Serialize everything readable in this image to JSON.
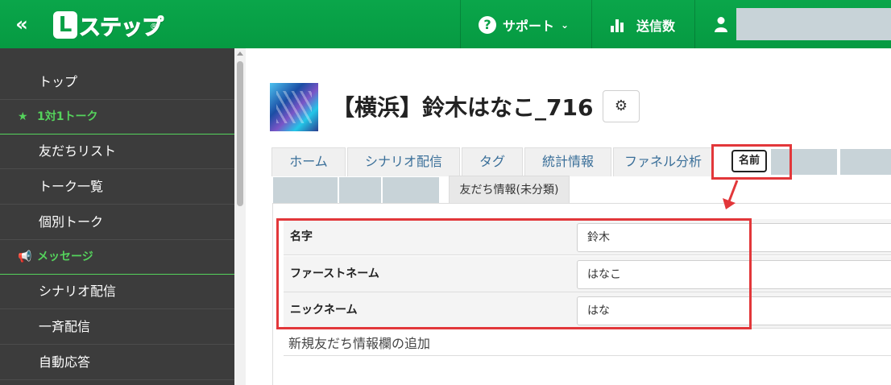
{
  "header": {
    "collapse_label": "«",
    "logo_badge": "L",
    "logo_text": "ステップ",
    "logo_reg": "®",
    "support_label": "サポート",
    "sends_label": "送信数"
  },
  "sidebar": {
    "items": [
      {
        "label": "トップ",
        "kind": "item"
      },
      {
        "label": "1対1トーク",
        "kind": "section",
        "icon": "star-icon"
      },
      {
        "label": "友だちリスト",
        "kind": "item"
      },
      {
        "label": "トーク一覧",
        "kind": "item"
      },
      {
        "label": "個別トーク",
        "kind": "item"
      },
      {
        "label": "メッセージ",
        "kind": "section",
        "icon": "megaphone-icon"
      },
      {
        "label": "シナリオ配信",
        "kind": "item"
      },
      {
        "label": "一斉配信",
        "kind": "item"
      },
      {
        "label": "自動応答",
        "kind": "item"
      }
    ]
  },
  "profile": {
    "title": "【横浜】鈴木はなこ_716"
  },
  "tabs": [
    {
      "label": "ホーム"
    },
    {
      "label": "シナリオ配信"
    },
    {
      "label": "タグ"
    },
    {
      "label": "統計情報"
    },
    {
      "label": "ファネル分析"
    },
    {
      "label": "名前"
    },
    {
      "label": "友だち情報(未分類)"
    }
  ],
  "fields": [
    {
      "label": "名字",
      "value": "鈴木"
    },
    {
      "label": "ファーストネーム",
      "value": "はなこ"
    },
    {
      "label": "ニックネーム",
      "value": "はな"
    }
  ],
  "add_field_label": "新規友だち情報欄の追加",
  "colors": {
    "brand_green": "#08a045",
    "sidebar_bg": "#3c3c3c",
    "section_green": "#55d35c",
    "highlight_red": "#e2373a"
  }
}
